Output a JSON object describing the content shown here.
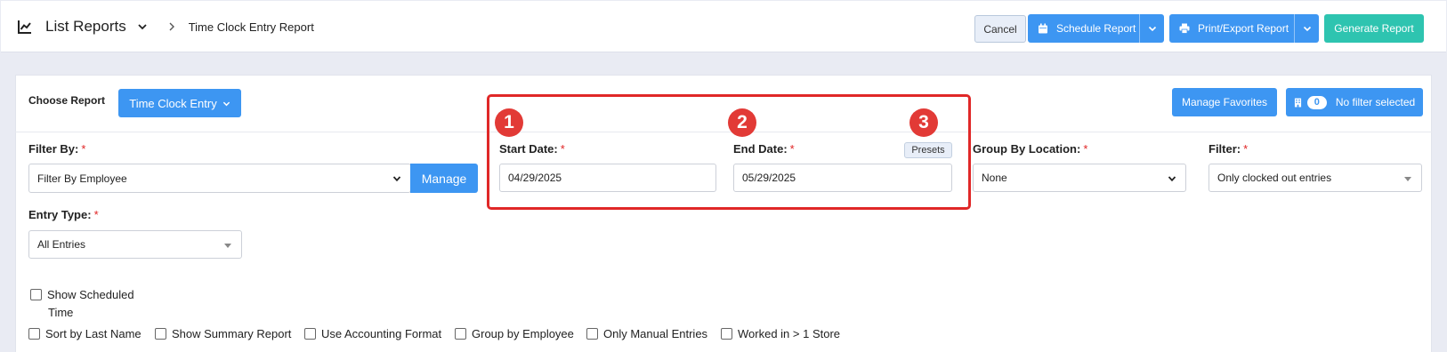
{
  "header": {
    "list_reports": "List Reports",
    "breadcrumb_current": "Time Clock Entry Report",
    "cancel_label": "Cancel",
    "schedule_label": "Schedule Report",
    "print_label": "Print/Export Report",
    "generate_label": "Generate Report"
  },
  "choose_report": {
    "label": "Choose Report",
    "selected": "Time Clock Entry"
  },
  "favorites": {
    "manage_label": "Manage Favorites",
    "filter_count": "0",
    "filter_text": "No filter selected"
  },
  "filter_by": {
    "label": "Filter By:",
    "value": "Filter By Employee",
    "manage_label": "Manage"
  },
  "start_date": {
    "label": "Start Date:",
    "value": "04/29/2025"
  },
  "end_date": {
    "label": "End Date:",
    "value": "05/29/2025"
  },
  "presets_label": "Presets",
  "group_by_location": {
    "label": "Group By Location:",
    "value": "None"
  },
  "filter": {
    "label": "Filter:",
    "value": "Only clocked out entries"
  },
  "entry_type": {
    "label": "Entry Type:",
    "value": "All Entries"
  },
  "required_mark": "*",
  "annotations": [
    "1",
    "2",
    "3"
  ],
  "checkboxes": {
    "show_scheduled": "Show Scheduled",
    "show_scheduled_2": "Time",
    "options": [
      "Sort by Last Name",
      "Show Summary Report",
      "Use Accounting Format",
      "Group by Employee",
      "Only Manual Entries",
      "Worked in > 1 Store"
    ]
  },
  "colors": {
    "primary": "#3d96f2",
    "teal": "#2ec4b0",
    "highlight": "#e02828",
    "background": "#e9ebf3"
  }
}
